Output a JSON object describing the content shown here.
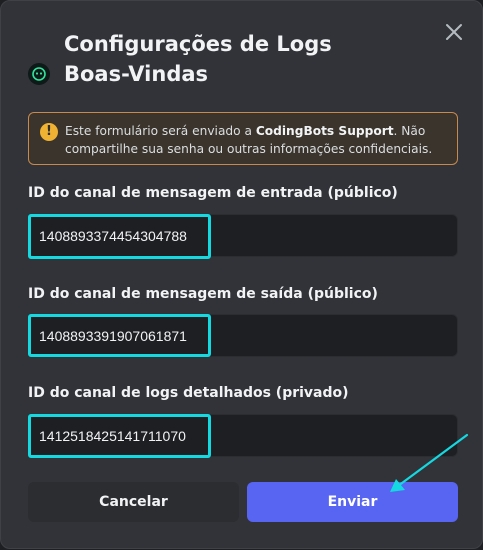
{
  "modal": {
    "title": "Configurações de Logs Boas-Vindas",
    "close_icon": "close-icon",
    "app_icon": "bot-avatar-icon"
  },
  "notice": {
    "icon": "warning-icon",
    "text_before": "Este formulário será enviado a ",
    "text_bold": "CodingBots Support",
    "text_after": ". Não compartilhe sua senha ou outras informações confidenciais."
  },
  "fields": [
    {
      "label": "ID do canal de mensagem de entrada (público)",
      "value": "1408893374454304788"
    },
    {
      "label": "ID do canal de mensagem de saída (público)",
      "value": "1408893391907061871"
    },
    {
      "label": "ID do canal de logs detalhados (privado)",
      "value": "1412518425141711070"
    }
  ],
  "buttons": {
    "cancel": "Cancelar",
    "submit": "Enviar"
  },
  "colors": {
    "background": "#313338",
    "accent": "#5865f2",
    "highlight": "#14d9e0",
    "warning": "#f0b232"
  }
}
